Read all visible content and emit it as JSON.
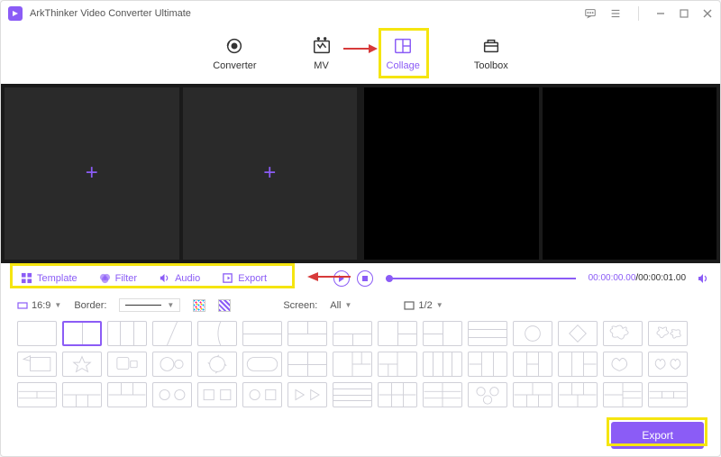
{
  "app": {
    "title": "ArkThinker Video Converter Ultimate"
  },
  "nav": {
    "converter": "Converter",
    "mv": "MV",
    "collage": "Collage",
    "toolbox": "Toolbox"
  },
  "tools": {
    "template": "Template",
    "filter": "Filter",
    "audio": "Audio",
    "export": "Export"
  },
  "playback": {
    "current": "00:00:00.00",
    "duration": "00:00:01.00"
  },
  "options": {
    "aspect": "16:9",
    "border_label": "Border:",
    "screen_label": "Screen:",
    "screen_value": "All",
    "page": "1/2"
  },
  "footer": {
    "export": "Export"
  }
}
